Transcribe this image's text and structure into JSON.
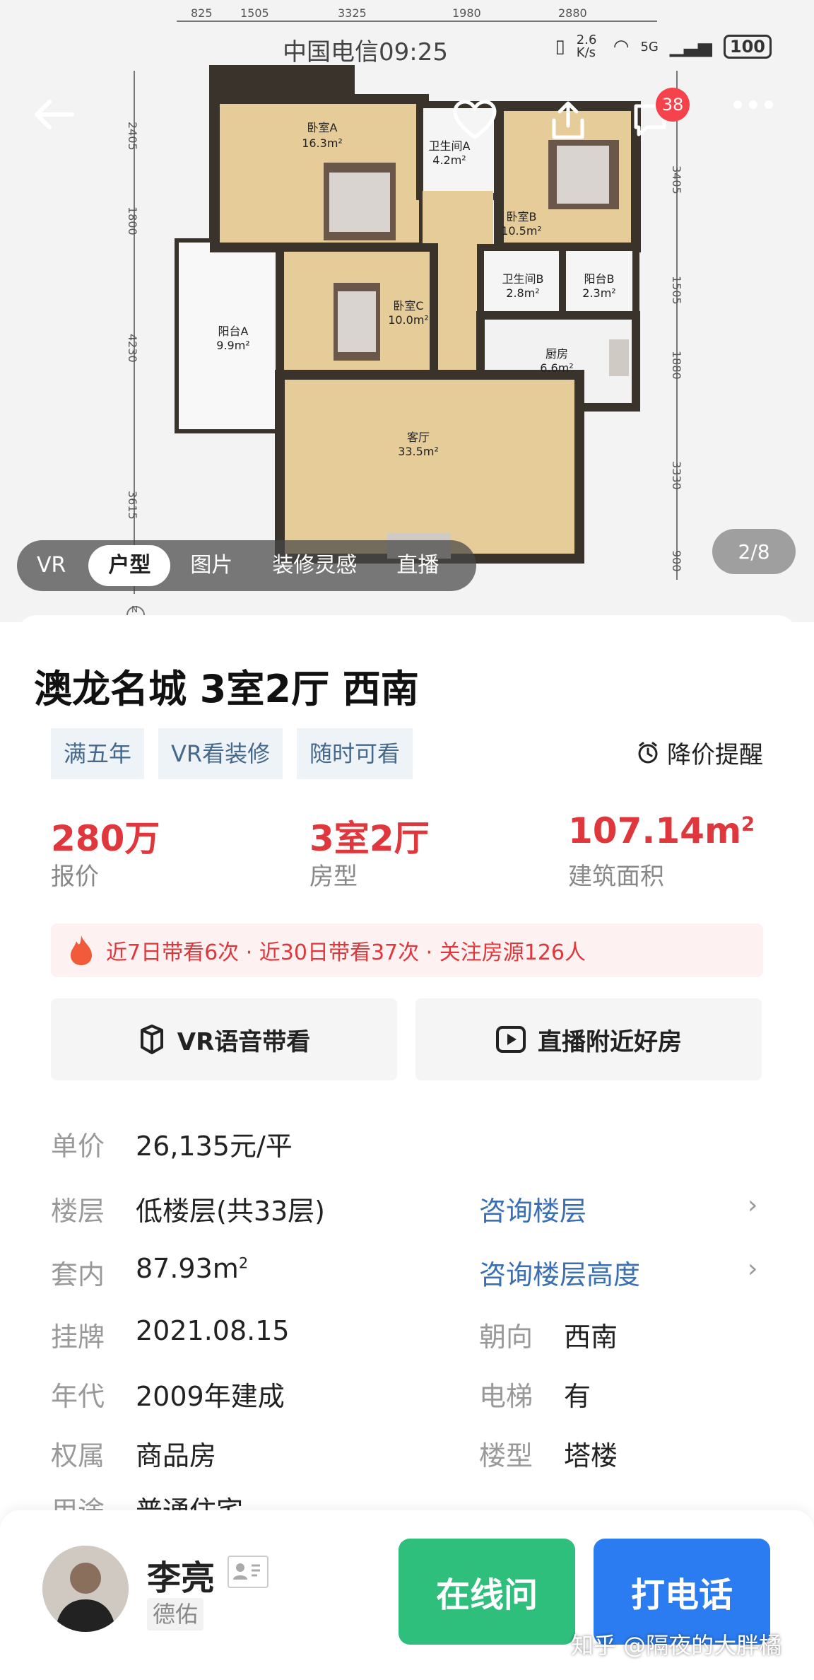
{
  "status_bar": {
    "time": "中国电信09:25",
    "net_speed": "2.6 K/s",
    "signal": "5G",
    "battery": "100"
  },
  "floor_plan": {
    "dims_top": [
      "825",
      "1505",
      "3325",
      "1980",
      "2880"
    ],
    "dims_left": [
      "2405",
      "1800",
      "4230",
      "3615"
    ],
    "dims_right": [
      "3405",
      "1505",
      "1880",
      "3330",
      "900"
    ],
    "rooms": [
      {
        "name": "卧室A",
        "area": "16.3m²"
      },
      {
        "name": "卫生间A",
        "area": "4.2m²"
      },
      {
        "name": "卧室B",
        "area": "10.5m²"
      },
      {
        "name": "卫生间B",
        "area": "2.8m²"
      },
      {
        "name": "阳台B",
        "area": "2.3m²"
      },
      {
        "name": "卧室C",
        "area": "10.0m²"
      },
      {
        "name": "阳台A",
        "area": "9.9m²"
      },
      {
        "name": "厨房",
        "area": "6.6m²"
      },
      {
        "name": "客厅",
        "area": "33.5m²"
      }
    ],
    "compass": "N"
  },
  "header": {
    "message_count": "38"
  },
  "media_tabs": [
    "VR",
    "户型",
    "图片",
    "装修灵感",
    "直播"
  ],
  "photo_counter": "2/8",
  "listing": {
    "title": "澳龙名城 3室2厅 西南",
    "tags": [
      "满五年",
      "VR看装修",
      "随时可看"
    ],
    "price_alert": "降价提醒",
    "stats": [
      {
        "value": "280万",
        "label": "报价"
      },
      {
        "value": "3室2厅",
        "label": "房型"
      },
      {
        "value": "107.14m",
        "sup": "2",
        "label": "建筑面积"
      }
    ],
    "heat": "近7日带看6次 · 近30日带看37次 · 关注房源126人",
    "actions": [
      "VR语音带看",
      "直播附近好房"
    ],
    "unit_price_label": "单价",
    "unit_price": "26,135元/平",
    "floor_label": "楼层",
    "floor": "低楼层(共33层)",
    "floor_link": "咨询楼层",
    "inner_area_label": "套内",
    "inner_area": "87.93m",
    "inner_area_sup": "2",
    "inner_area_link": "咨询楼层高度",
    "listed_label": "挂牌",
    "listed": "2021.08.15",
    "orientation_label": "朝向",
    "orientation": "西南",
    "year_label": "年代",
    "year": "2009年建成",
    "elevator_label": "电梯",
    "elevator": "有",
    "ownership_label": "权属",
    "ownership": "商品房",
    "building_type_label": "楼型",
    "building_type": "塔楼",
    "usage_label": "用途",
    "usage": "普通住宅"
  },
  "agent": {
    "name": "李亮",
    "company": "德佑",
    "online_label": "在线问",
    "call_label": "打电话"
  },
  "watermark": "知乎 @隔夜的大胖橘",
  "colors": {
    "price_red": "#e0373c",
    "link_blue": "#3b6fb4",
    "online_green": "#2fbf7c",
    "call_blue": "#2b7cf0",
    "floor_wood": "#e6cc98",
    "wall": "#3a332c"
  }
}
